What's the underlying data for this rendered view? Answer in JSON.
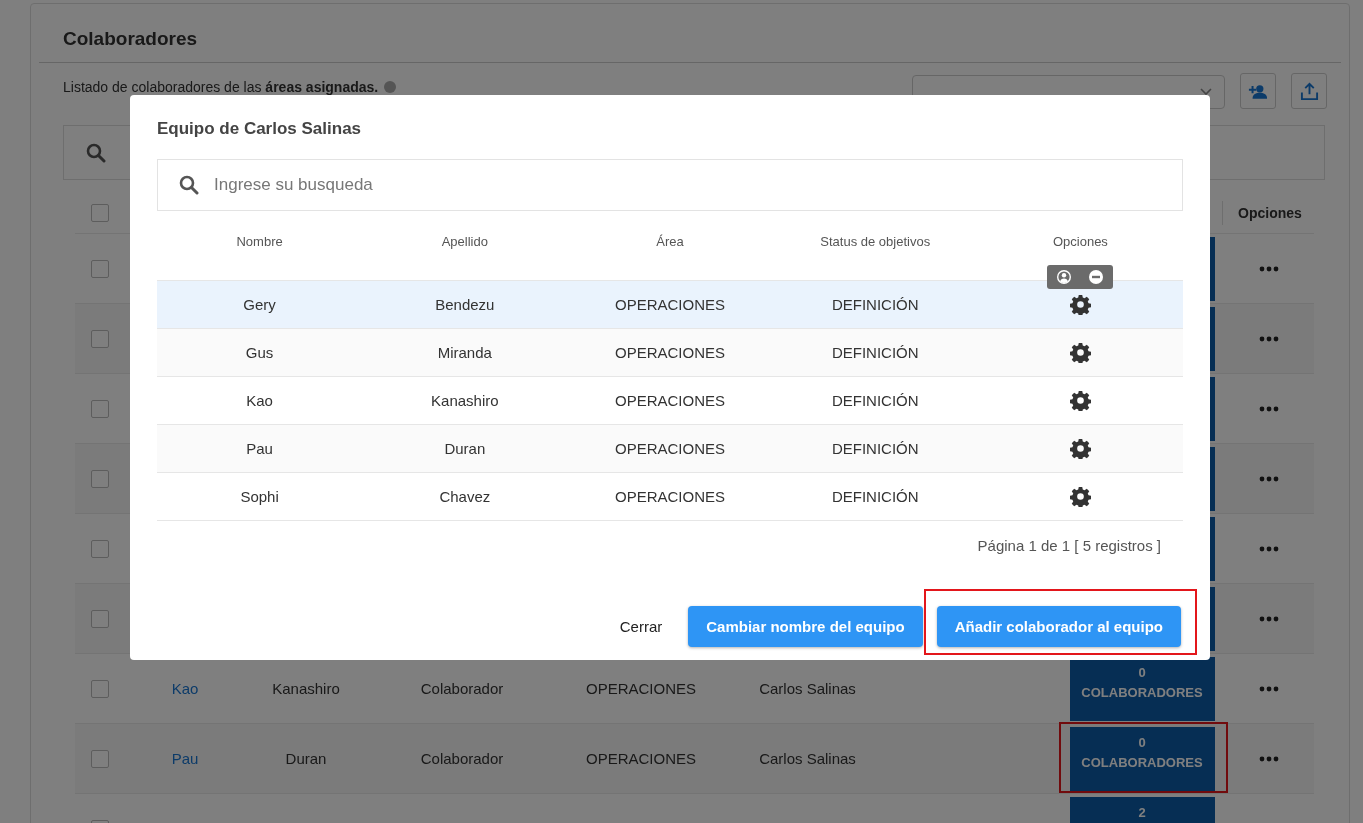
{
  "page": {
    "title": "Colaboradores",
    "description": "Listado de colaboradores de las **áreas asignadas.**",
    "area_select": {
      "open": false
    },
    "table": {
      "all_checked": false,
      "columns": [
        "Opciones"
      ],
      "rows": [
        {
          "checked": false
        },
        {
          "checked": false
        },
        {
          "checked": false
        },
        {
          "checked": false
        },
        {
          "checked": false
        },
        {
          "checked": false
        },
        {
          "checked": false,
          "name": "Kao",
          "surname": "Kanashiro",
          "role": "Colaborador",
          "area": "OPERACIONES",
          "boss": "Carlos Salinas",
          "team_count": "0",
          "team_label": "COLABORADORES",
          "highlighted": false
        },
        {
          "checked": false,
          "name": "Pau",
          "surname": "Duran",
          "role": "Colaborador",
          "area": "OPERACIONES",
          "boss": "Carlos Salinas",
          "team_count": "0",
          "team_label": "COLABORADORES",
          "highlighted": true
        },
        {
          "checked": false,
          "team_count": "2"
        }
      ]
    }
  },
  "dialog": {
    "title": "Equipo de Carlos Salinas",
    "search": {
      "placeholder": "Ingrese su busqueda"
    },
    "columns": [
      "Nombre",
      "Apellido",
      "Área",
      "Status de objetivos",
      "Opciones"
    ],
    "rows": [
      {
        "name": "Gery",
        "surname": "Bendezu",
        "area": "OPERACIONES",
        "status": "DEFINICIÓN",
        "hovered": true,
        "tooltip": true
      },
      {
        "name": "Gus",
        "surname": "Miranda",
        "area": "OPERACIONES",
        "status": "DEFINICIÓN",
        "hovered": false,
        "tooltip": false
      },
      {
        "name": "Kao",
        "surname": "Kanashiro",
        "area": "OPERACIONES",
        "status": "DEFINICIÓN",
        "hovered": false,
        "tooltip": false
      },
      {
        "name": "Pau",
        "surname": "Duran",
        "area": "OPERACIONES",
        "status": "DEFINICIÓN",
        "hovered": false,
        "tooltip": false
      },
      {
        "name": "Sophi",
        "surname": "Chavez",
        "area": "OPERACIONES",
        "status": "DEFINICIÓN",
        "hovered": false,
        "tooltip": false
      }
    ],
    "pagination": "Página 1 de 1 [ 5 registros ]",
    "buttons": [
      {
        "label": "Cerrar",
        "kind": "link",
        "highlighted": false
      },
      {
        "label": "Cambiar nombre del equipo",
        "kind": "primary",
        "highlighted": false
      },
      {
        "label": "Añadir colaborador al equipo",
        "kind": "primary",
        "highlighted": true
      }
    ]
  }
}
